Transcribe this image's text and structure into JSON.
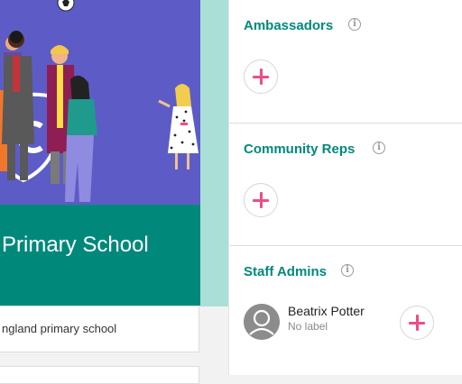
{
  "school": {
    "name": "Primary School",
    "description": "ngland primary school"
  },
  "sections": {
    "ambassadors": {
      "title": "Ambassadors",
      "info_icon": "info-icon",
      "add_icon": "plus-icon"
    },
    "community_reps": {
      "title": "Community Reps",
      "info_icon": "info-icon",
      "add_icon": "plus-icon"
    },
    "staff_admins": {
      "title": "Staff Admins",
      "info_icon": "info-icon",
      "add_icon": "plus-icon",
      "members": [
        {
          "name": "Beatrix Potter",
          "label": "No label",
          "avatar_icon": "user-avatar-icon"
        }
      ]
    }
  },
  "colors": {
    "accent_teal": "#00897b",
    "hero_purple": "#5d5cc6",
    "add_pink": "#ec4d8b",
    "stripe_teal": "#aadfd8"
  }
}
